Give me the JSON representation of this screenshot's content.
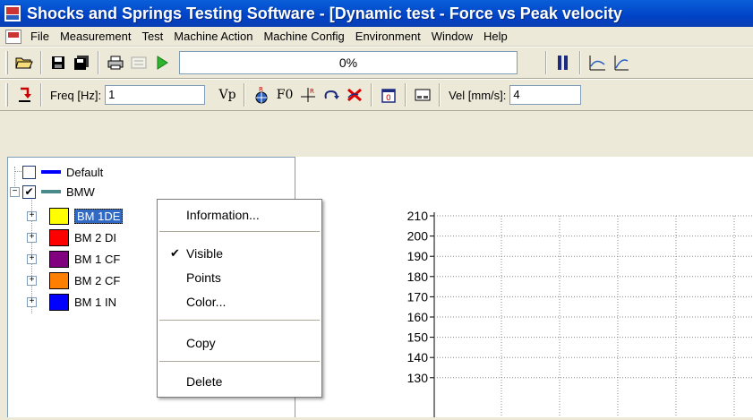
{
  "window": {
    "title": "Shocks and Springs Testing Software - [Dynamic test - Force vs Peak velocity"
  },
  "menu": [
    "File",
    "Measurement",
    "Test",
    "Machine Action",
    "Machine Config",
    "Environment",
    "Window",
    "Help"
  ],
  "toolbar1": {
    "progress_text": "0%",
    "progress_value": 0
  },
  "toolbar2": {
    "freq_label": "Freq [Hz]:",
    "freq_value": "1",
    "vp_label": "Vp",
    "f0_label": "F0",
    "vel_label": "Vel [mm/s]:",
    "vel_value": "4"
  },
  "tree": {
    "items": [
      {
        "label": "Default",
        "checked": false,
        "line_color": "#0000ff"
      },
      {
        "label": "BMW",
        "checked": true,
        "line_color": "#4a8a8a"
      }
    ],
    "children": [
      {
        "label": "BM 1DE",
        "color": "#ffff00",
        "selected": true
      },
      {
        "label": "BM 2 DI",
        "color": "#ff0000"
      },
      {
        "label": "BM 1 CF",
        "color": "#800080"
      },
      {
        "label": "BM 2 CF",
        "color": "#ff8000"
      },
      {
        "label": "BM 1 IN",
        "color": "#0000ff"
      }
    ]
  },
  "context_menu": {
    "information": "Information...",
    "visible": "Visible",
    "visible_check": "✔",
    "points": "Points",
    "color": "Color...",
    "copy": "Copy",
    "delete": "Delete"
  },
  "chart_data": {
    "type": "line",
    "y_ticks": [
      210,
      200,
      190,
      180,
      170,
      160,
      150,
      140,
      130
    ],
    "ylim": [
      130,
      210
    ],
    "grid": true,
    "series": []
  }
}
